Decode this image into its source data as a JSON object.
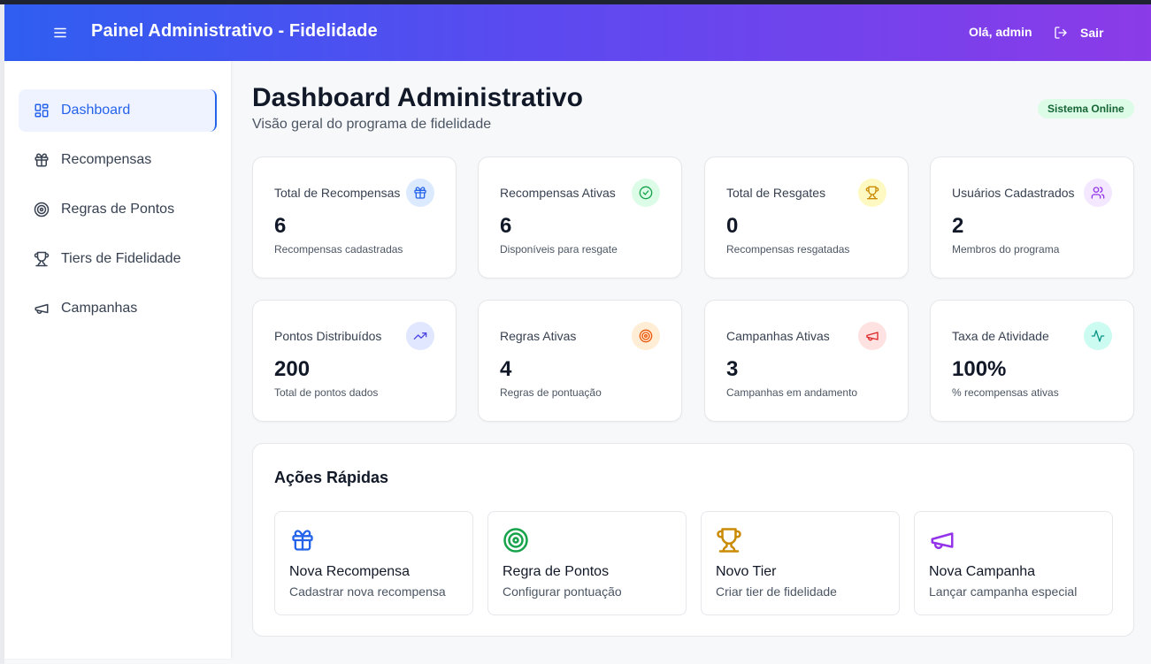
{
  "header": {
    "title": "Painel Administrativo - Fidelidade",
    "greeting": "Olá, admin",
    "logout_label": "Sair"
  },
  "sidebar": {
    "items": [
      {
        "label": "Dashboard",
        "icon": "dashboard-grid-icon",
        "active": true
      },
      {
        "label": "Recompensas",
        "icon": "gift-icon"
      },
      {
        "label": "Regras de Pontos",
        "icon": "target-icon"
      },
      {
        "label": "Tiers de Fidelidade",
        "icon": "trophy-icon"
      },
      {
        "label": "Campanhas",
        "icon": "megaphone-icon"
      }
    ]
  },
  "main": {
    "title": "Dashboard Administrativo",
    "subtitle": "Visão geral do programa de fidelidade",
    "status": "Sistema Online"
  },
  "stats": [
    {
      "label": "Total de Recompensas",
      "value": "6",
      "desc": "Recompensas cadastradas",
      "icon": "gift-icon",
      "color": "#2563eb",
      "bg": "#dbeafe"
    },
    {
      "label": "Recompensas Ativas",
      "value": "6",
      "desc": "Disponíveis para resgate",
      "icon": "check-circle-icon",
      "color": "#16a34a",
      "bg": "#dcfce7"
    },
    {
      "label": "Total de Resgates",
      "value": "0",
      "desc": "Recompensas resgatadas",
      "icon": "trophy-icon",
      "color": "#ca8a04",
      "bg": "#fef9c3"
    },
    {
      "label": "Usuários Cadastrados",
      "value": "2",
      "desc": "Membros do programa",
      "icon": "users-icon",
      "color": "#9333ea",
      "bg": "#f3e8ff"
    },
    {
      "label": "Pontos Distribuídos",
      "value": "200",
      "desc": "Total de pontos dados",
      "icon": "trending-up-icon",
      "color": "#4f46e5",
      "bg": "#e0e7ff"
    },
    {
      "label": "Regras Ativas",
      "value": "4",
      "desc": "Regras de pontuação",
      "icon": "target-icon",
      "color": "#ea580c",
      "bg": "#ffedd5"
    },
    {
      "label": "Campanhas Ativas",
      "value": "3",
      "desc": "Campanhas em andamento",
      "icon": "megaphone-icon",
      "color": "#dc2626",
      "bg": "#fee2e2"
    },
    {
      "label": "Taxa de Atividade",
      "value": "100%",
      "desc": "% recompensas ativas",
      "icon": "activity-icon",
      "color": "#0d9488",
      "bg": "#ccfbf1"
    }
  ],
  "quick_actions": {
    "title": "Ações Rápidas",
    "items": [
      {
        "label": "Nova Recompensa",
        "desc": "Cadastrar nova recompensa",
        "icon": "gift-icon",
        "color": "#2563eb"
      },
      {
        "label": "Regra de Pontos",
        "desc": "Configurar pontuação",
        "icon": "target-icon",
        "color": "#16a34a"
      },
      {
        "label": "Novo Tier",
        "desc": "Criar tier de fidelidade",
        "icon": "trophy-icon",
        "color": "#ca8a04"
      },
      {
        "label": "Nova Campanha",
        "desc": "Lançar campanha especial",
        "icon": "megaphone-icon",
        "color": "#9333ea"
      }
    ]
  }
}
